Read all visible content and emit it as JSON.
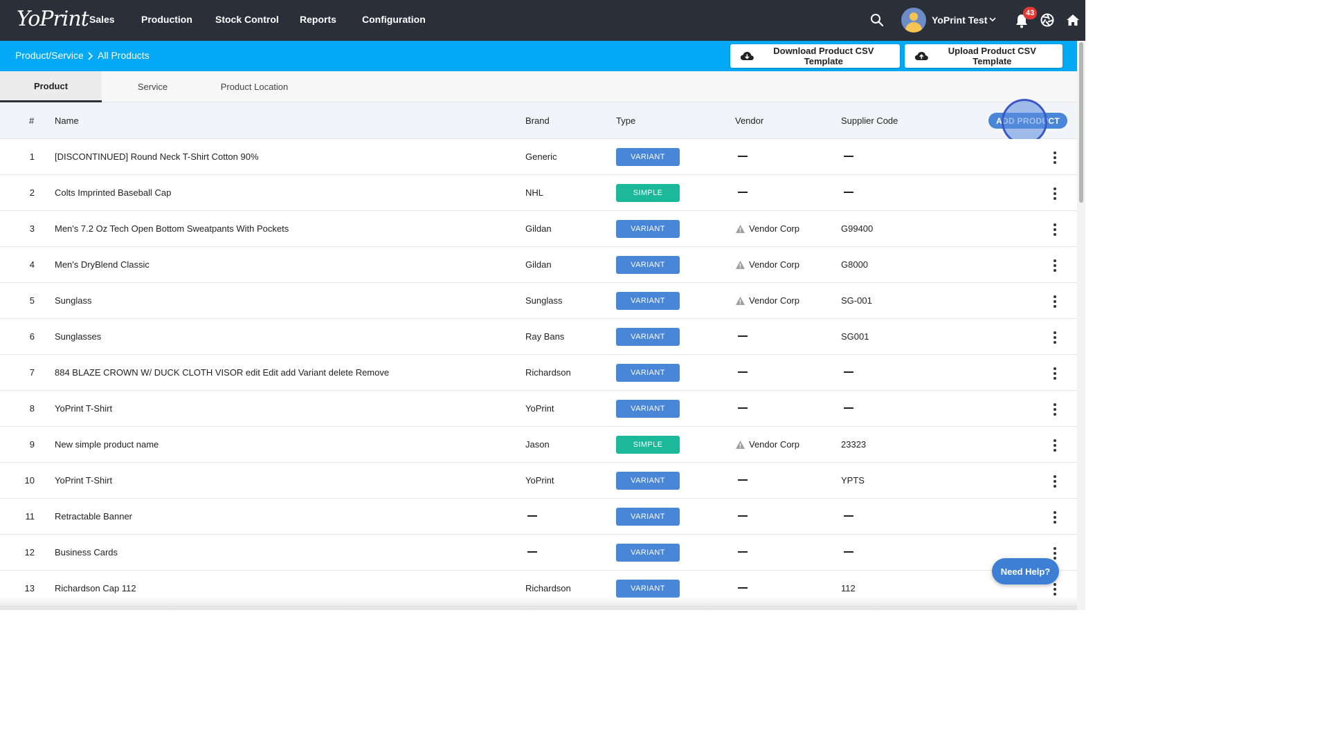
{
  "app": {
    "logo": "YoPrint"
  },
  "nav": {
    "items": [
      {
        "label": "Sales"
      },
      {
        "label": "Production"
      },
      {
        "label": "Stock Control"
      },
      {
        "label": "Reports"
      },
      {
        "label": "Configuration"
      }
    ],
    "user_name": "YoPrint Test",
    "notification_count": "43"
  },
  "breadcrumb": {
    "parent": "Product/Service",
    "current": "All Products"
  },
  "actions": {
    "download_csv": "Download Product CSV Template",
    "upload_csv": "Upload Product CSV Template",
    "add_product": "ADD PRODUCT"
  },
  "tabs": [
    {
      "label": "Product",
      "active": true
    },
    {
      "label": "Service",
      "active": false
    },
    {
      "label": "Product Location",
      "active": false
    }
  ],
  "table": {
    "columns": {
      "num": "#",
      "name": "Name",
      "brand": "Brand",
      "type": "Type",
      "vendor": "Vendor",
      "supplier_code": "Supplier Code"
    },
    "rows": [
      {
        "num": "1",
        "name": "[DISCONTINUED] Round Neck T-Shirt Cotton 90%",
        "brand": "Generic",
        "type": "VARIANT",
        "vendor": "",
        "vendor_warning": false,
        "supplier_code": ""
      },
      {
        "num": "2",
        "name": "Colts Imprinted Baseball Cap",
        "brand": "NHL",
        "type": "SIMPLE",
        "vendor": "",
        "vendor_warning": false,
        "supplier_code": ""
      },
      {
        "num": "3",
        "name": "Men's 7.2 Oz Tech Open Bottom Sweatpants With Pockets",
        "brand": "Gildan",
        "type": "VARIANT",
        "vendor": "Vendor Corp",
        "vendor_warning": true,
        "supplier_code": "G99400"
      },
      {
        "num": "4",
        "name": "Men's DryBlend Classic",
        "brand": "Gildan",
        "type": "VARIANT",
        "vendor": "Vendor Corp",
        "vendor_warning": true,
        "supplier_code": "G8000"
      },
      {
        "num": "5",
        "name": "Sunglass",
        "brand": "Sunglass",
        "type": "VARIANT",
        "vendor": "Vendor Corp",
        "vendor_warning": true,
        "supplier_code": "SG-001"
      },
      {
        "num": "6",
        "name": "Sunglasses",
        "brand": "Ray Bans",
        "type": "VARIANT",
        "vendor": "",
        "vendor_warning": false,
        "supplier_code": "SG001"
      },
      {
        "num": "7",
        "name": "884 BLAZE CROWN W/ DUCK CLOTH VISOR edit Edit add Variant delete Remove",
        "brand": "Richardson",
        "type": "VARIANT",
        "vendor": "",
        "vendor_warning": false,
        "supplier_code": ""
      },
      {
        "num": "8",
        "name": "YoPrint T-Shirt",
        "brand": "YoPrint",
        "type": "VARIANT",
        "vendor": "",
        "vendor_warning": false,
        "supplier_code": ""
      },
      {
        "num": "9",
        "name": "New simple product name",
        "brand": "Jason",
        "type": "SIMPLE",
        "vendor": "Vendor Corp",
        "vendor_warning": true,
        "supplier_code": "23323"
      },
      {
        "num": "10",
        "name": "YoPrint T-Shirt",
        "brand": "YoPrint",
        "type": "VARIANT",
        "vendor": "",
        "vendor_warning": false,
        "supplier_code": "YPTS"
      },
      {
        "num": "11",
        "name": "Retractable Banner",
        "brand": "",
        "type": "VARIANT",
        "vendor": "",
        "vendor_warning": false,
        "supplier_code": ""
      },
      {
        "num": "12",
        "name": "Business Cards",
        "brand": "",
        "type": "VARIANT",
        "vendor": "",
        "vendor_warning": false,
        "supplier_code": ""
      },
      {
        "num": "13",
        "name": "Richardson Cap 112",
        "brand": "Richardson",
        "type": "VARIANT",
        "vendor": "",
        "vendor_warning": false,
        "supplier_code": "112"
      }
    ]
  },
  "help": {
    "label": "Need Help?"
  },
  "colors": {
    "nav_bg": "#2b2f38",
    "accent": "#03a9f4",
    "variant_badge": "#4a86d8",
    "simple_badge": "#1bb99a",
    "primary_button": "#4a86d8"
  },
  "icons": {
    "search": "search-icon",
    "notifications": "bell-icon",
    "aperture": "aperture-icon",
    "home": "home-icon",
    "cloud_download": "cloud-download-icon",
    "cloud_upload": "cloud-upload-icon",
    "warning": "warning-icon",
    "row_menu": "more-vertical-icon"
  }
}
